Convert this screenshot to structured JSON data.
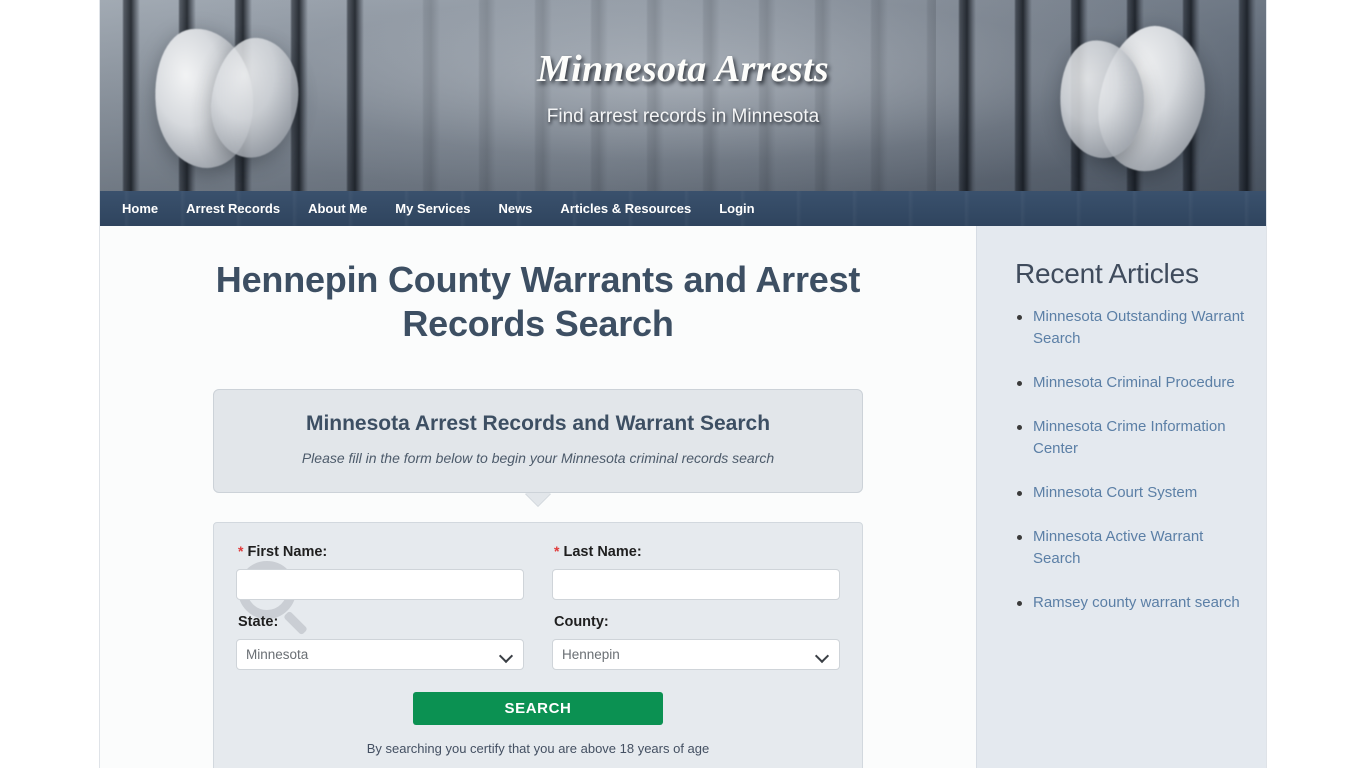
{
  "site": {
    "title": "Minnesota Arrests",
    "tagline": "Find arrest records in Minnesota"
  },
  "nav": {
    "items": [
      {
        "label": "Home"
      },
      {
        "label": "Arrest Records"
      },
      {
        "label": "About Me"
      },
      {
        "label": "My Services"
      },
      {
        "label": "News"
      },
      {
        "label": "Articles & Resources"
      },
      {
        "label": "Login"
      }
    ]
  },
  "main": {
    "page_title": "Hennepin County Warrants and Arrest Records Search",
    "bubble": {
      "heading": "Minnesota Arrest Records and Warrant Search",
      "subtext": "Please fill in the form below to begin your Minnesota criminal records search"
    },
    "form": {
      "first_name": {
        "label": "First Name:",
        "required_marker": "*",
        "value": "",
        "placeholder": ""
      },
      "last_name": {
        "label": "Last Name:",
        "required_marker": "*",
        "value": "",
        "placeholder": ""
      },
      "state": {
        "label": "State:",
        "selected": "Minnesota",
        "options": [
          "Minnesota"
        ]
      },
      "county": {
        "label": "County:",
        "selected": "Hennepin",
        "options": [
          "Hennepin"
        ]
      },
      "search_button": "SEARCH",
      "disclaimer": "By searching you certify that you are above 18 years of age"
    }
  },
  "sidebar": {
    "heading": "Recent Articles",
    "articles": [
      {
        "label": "Minnesota Outstanding Warrant Search"
      },
      {
        "label": "Minnesota Criminal Procedure"
      },
      {
        "label": "Minnesota Crime Information Center"
      },
      {
        "label": "Minnesota Court System"
      },
      {
        "label": "Minnesota Active Warrant Search"
      },
      {
        "label": "Ramsey county warrant search"
      }
    ]
  },
  "colors": {
    "nav_bg": "#2f445e",
    "heading": "#3d4f63",
    "link": "#5b7fa6",
    "search_button": "#0b9152",
    "required": "#e03a3a",
    "sidebar_bg": "#e4e9ef"
  }
}
